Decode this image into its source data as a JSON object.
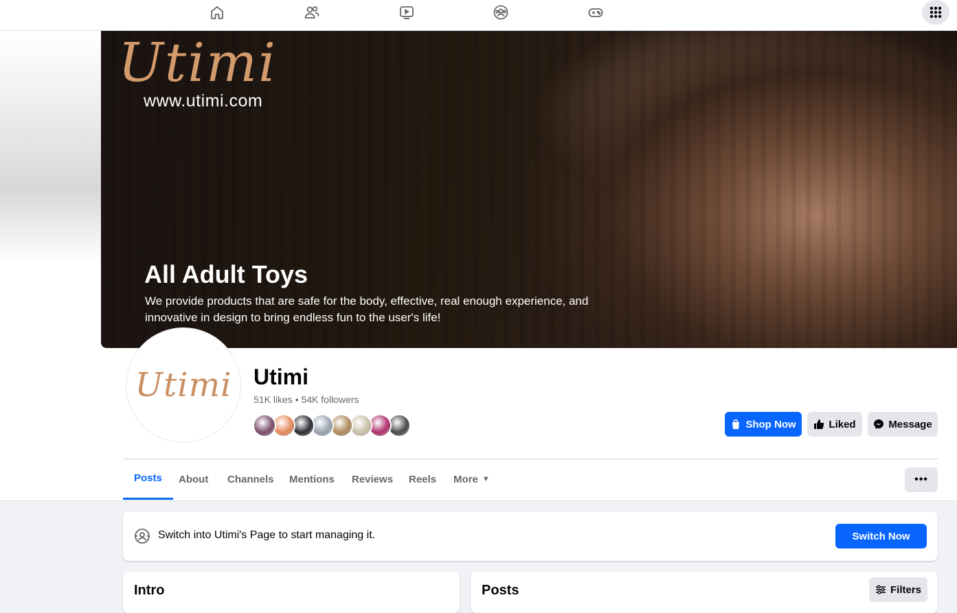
{
  "topnav": {
    "icons": [
      "home-icon",
      "friends-icon",
      "watch-icon",
      "groups-icon",
      "gaming-icon"
    ],
    "menu_icon": "grid-menu-icon"
  },
  "cover": {
    "logo_text": "Utimi",
    "url": "www.utimi.com",
    "headline": "All Adult Toys",
    "description": "We provide products that are safe for the body, effective, real enough experience, and innovative in design to bring endless fun to the user's life!"
  },
  "profile": {
    "avatar_logo": "Utimi",
    "name": "Utimi",
    "stats": "51K likes • 54K followers",
    "follower_colors": [
      "#7a4e6b",
      "#e58a5c",
      "#2c2c34",
      "#9aa4b0",
      "#b08a5a",
      "#c8c0a8",
      "#b0306f",
      "#4a4a4a"
    ]
  },
  "actions": {
    "shop_now": "Shop Now",
    "liked": "Liked",
    "message": "Message"
  },
  "tabs": [
    {
      "label": "Posts",
      "active": true
    },
    {
      "label": "About",
      "active": false
    },
    {
      "label": "Channels",
      "active": false
    },
    {
      "label": "Mentions",
      "active": false
    },
    {
      "label": "Reviews",
      "active": false
    },
    {
      "label": "Reels",
      "active": false
    },
    {
      "label": "More",
      "active": false
    }
  ],
  "overflow_label": "•••",
  "switch_banner": {
    "text": "Switch into Utimi's Page to start managing it.",
    "button": "Switch Now"
  },
  "intro": {
    "title": "Intro"
  },
  "posts": {
    "title": "Posts",
    "filters": "Filters"
  },
  "colors": {
    "accent": "#0866ff",
    "secondary_button": "#e4e6eb",
    "background": "#f0f2f5"
  }
}
